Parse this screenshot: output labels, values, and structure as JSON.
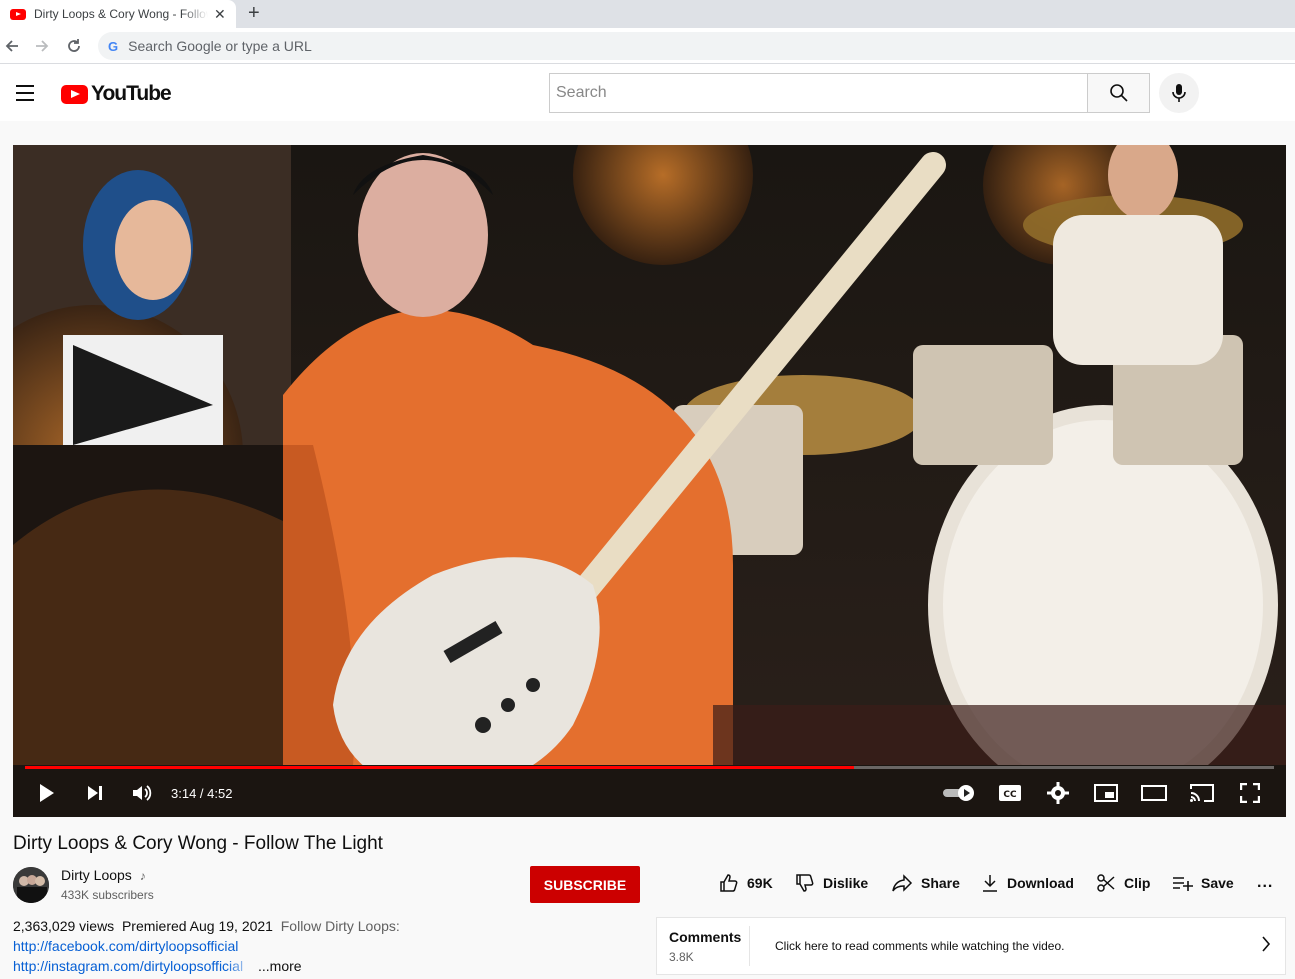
{
  "browser": {
    "tab_title": "Dirty Loops & Cory Wong - Follow The Light",
    "tab_close": "✕",
    "new_tab": "+",
    "omnibox_placeholder": "Search Google or type a URL",
    "omnibox_g": "G"
  },
  "header": {
    "logo_text": "YouTube",
    "search_placeholder": "Search"
  },
  "player": {
    "current_time": "3:14",
    "duration": "4:52",
    "time_display": "3:14 / 4:52",
    "progress_fraction": 0.664
  },
  "video": {
    "title": "Dirty Loops & Cory Wong - Follow The Light",
    "channel_name": "Dirty Loops",
    "channel_badge": "♪",
    "subscribers": "433K subscribers",
    "subscribe_label": "SUBSCRIBE"
  },
  "actions": {
    "like": "69K",
    "dislike": "Dislike",
    "share": "Share",
    "download": "Download",
    "clip": "Clip",
    "save": "Save",
    "more": "..."
  },
  "description": {
    "views": "2,363,029 views",
    "premiered": "Premiered Aug 19, 2021",
    "snippet": "Follow Dirty Loops:",
    "link_facebook": "http://facebook.com/dirtyloopsofficial",
    "link_instagram": "http://instagram.com/dirtyloopsofficial",
    "more_label": "...more"
  },
  "comments": {
    "title": "Comments",
    "count": "3.8K",
    "hint": "Click here to read comments while watching the video."
  },
  "colors": {
    "brand_red": "#ff0000",
    "subscribe_red": "#cc0000",
    "link_blue": "#065fd4"
  }
}
